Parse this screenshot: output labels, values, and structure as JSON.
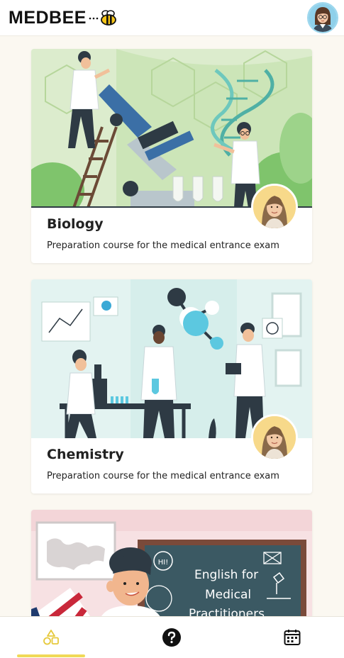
{
  "header": {
    "logo_text": "MEDBEE",
    "logo_icon": "bee-icon",
    "avatar": "profile-avatar"
  },
  "courses": [
    {
      "title": "Biology",
      "description": "Preparation course for the medical entrance exam",
      "illustration": "biology-lab-illustration"
    },
    {
      "title": "Chemistry",
      "description": "Preparation course for the medical entrance exam",
      "illustration": "chemistry-lab-illustration"
    },
    {
      "title": "",
      "illustration_text": [
        "English for",
        "Medical",
        "Practitioners"
      ],
      "bubble_text": "HI!",
      "illustration": "english-illustration"
    }
  ],
  "bottom_nav": {
    "items": [
      {
        "icon": "shapes-icon",
        "active": true
      },
      {
        "icon": "help-icon",
        "active": false
      },
      {
        "icon": "calendar-icon",
        "active": false
      }
    ]
  },
  "colors": {
    "accent": "#f0d957",
    "background": "#fbf8f1"
  }
}
